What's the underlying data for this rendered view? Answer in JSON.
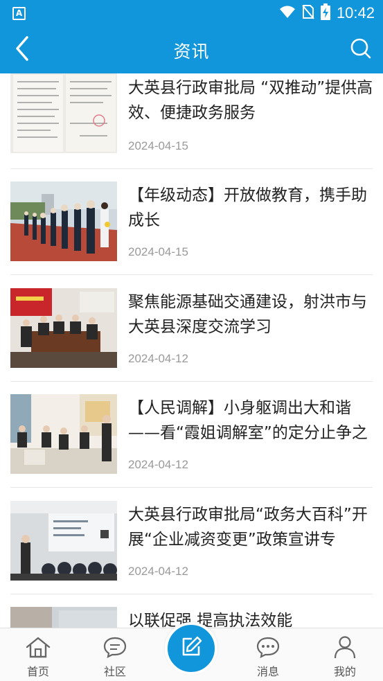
{
  "status_bar": {
    "time": "10:42"
  },
  "header": {
    "title": "资讯",
    "accent_color": "#1296db"
  },
  "news": [
    {
      "title": "大英县行政审批局 “双推动”提供高效、便捷政务服务",
      "date": "2024-04-15"
    },
    {
      "title": "【年级动态】开放做教育，携手助成长",
      "date": "2024-04-15"
    },
    {
      "title": "聚焦能源基础交通建设，射洪市与大英县深度交流学习",
      "date": "2024-04-12"
    },
    {
      "title": "【人民调解】小身躯调出大和谐——看“霞姐调解室”的定分止争之",
      "date": "2024-04-12"
    },
    {
      "title": "大英县行政审批局“政务大百科”开展“企业减资变更”政策宣讲专",
      "date": "2024-04-12"
    },
    {
      "title": "以联促强 提高执法效能",
      "date": ""
    }
  ],
  "bottom_nav": {
    "home": "首页",
    "community": "社区",
    "messages": "消息",
    "mine": "我的"
  }
}
